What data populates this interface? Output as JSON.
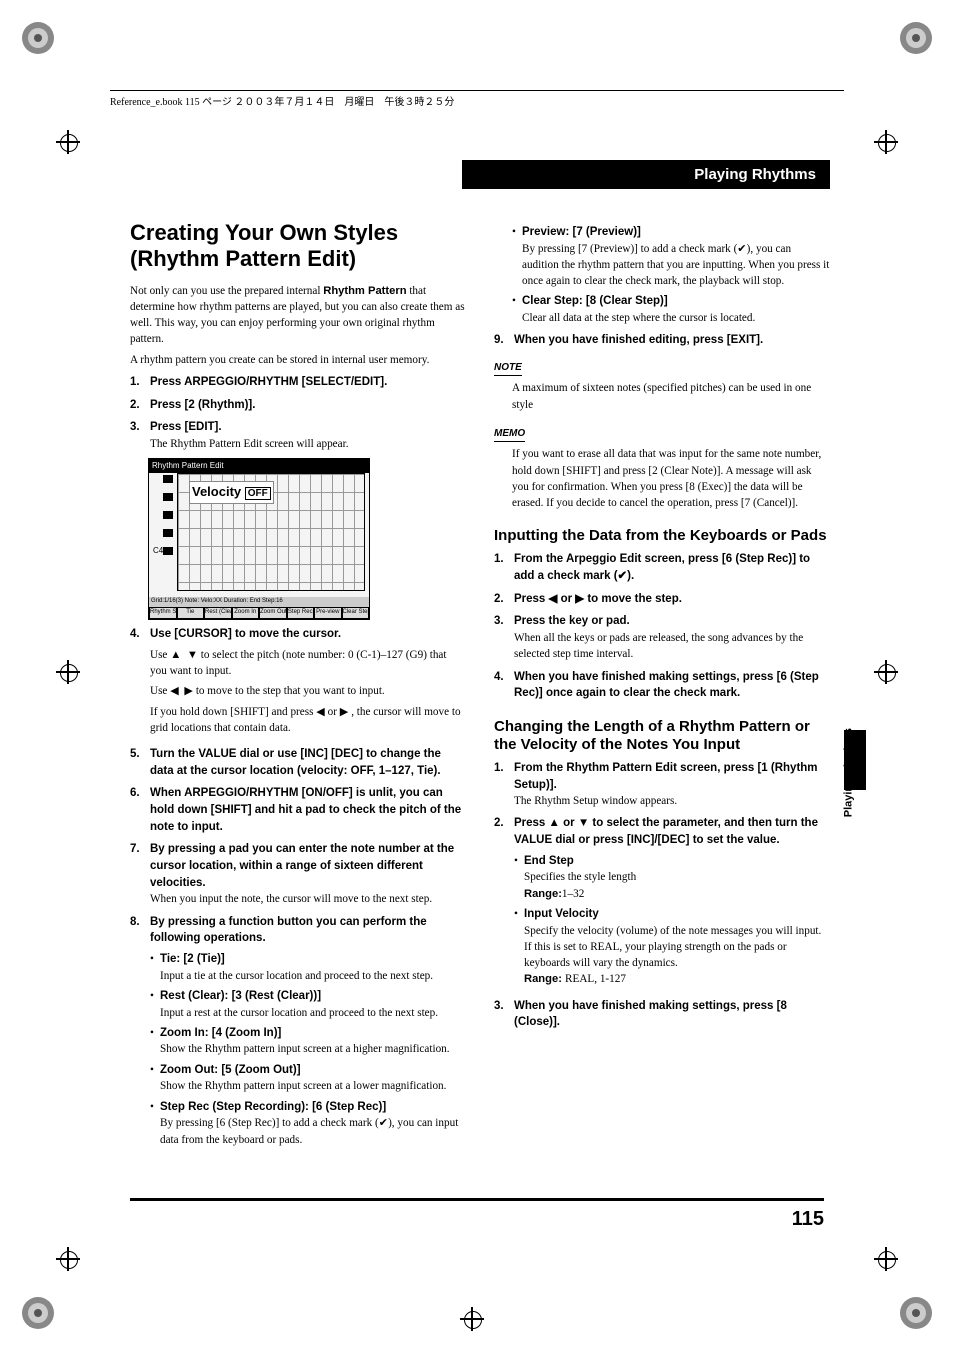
{
  "header": {
    "running": "Reference_e.book  115 ページ  ２００３年７月１４日　月曜日　午後３時２５分"
  },
  "section_label": "Playing Rhythms",
  "side_tab": "Playing Rhythms",
  "page_number": "115",
  "article": {
    "title": "Creating Your Own Styles (Rhythm Pattern Edit)",
    "intro1": "Not only can you use the prepared internal ",
    "intro1_bold": "Rhythm Pattern",
    "intro1_cont": " that determine how rhythm patterns are played, but you can also create them as well. This way, you can enjoy performing your own original rhythm pattern.",
    "intro2": "A rhythm pattern you create can be stored in internal user memory."
  },
  "screenshot": {
    "title": "Rhythm Pattern Edit",
    "velocity": "Velocity",
    "velocity_val": "OFF",
    "c4": "C4",
    "velo_row": "Velo",
    "info_row": "Grid:1/16(3)   Note:  Velo:XX  Duration:    End Step:16",
    "tabs": [
      "Rhythm Setup",
      "Tie",
      "Rest (Clear)",
      "Zoom In",
      "Zoom Out",
      "Step Rec",
      "Pre-view",
      "Clear Step"
    ]
  },
  "stepsL": {
    "s1": "Press ARPEGGIO/RHYTHM [SELECT/EDIT].",
    "s2": "Press [2 (Rhythm)].",
    "s3": "Press [EDIT].",
    "s3b": "The Rhythm Pattern Edit screen will appear.",
    "s4": "Use [CURSOR] to move the cursor.",
    "s4a_pre": "Use  ",
    "s4a_post": "  to select the pitch (note number: 0 (C-1)–127 (G9) that you want to input.",
    "s4b_pre": "Use  ",
    "s4b_post": "  to move to the step that you want to input.",
    "s4c_pre": "If you hold down [SHIFT] and press  ",
    "s4c_mid": "  or  ",
    "s4c_post": " , the cursor will move to grid locations that contain data.",
    "s5": "Turn the VALUE dial or use [INC] [DEC] to change the data at the cursor location (velocity: OFF, 1–127, Tie).",
    "s6": "When ARPEGGIO/RHYTHM [ON/OFF] is unlit, you can hold down [SHIFT] and hit a pad to check the pitch of the note to input.",
    "s7": "By pressing a pad you can enter the note number at the cursor location, within a range of sixteen different velocities.",
    "s7b": "When you input the note, the cursor will move to the next step.",
    "s8": "By pressing a function button you can perform the following operations.",
    "b_tie_h": "Tie: [2 (Tie)]",
    "b_tie_b": "Input a tie at the cursor location and proceed to the next step.",
    "b_rest_h": "Rest (Clear): [3 (Rest (Clear))]",
    "b_rest_b": "Input a rest at the cursor location and proceed to the next step.",
    "b_zin_h": "Zoom In: [4 (Zoom In)]",
    "b_zin_b": "Show the Rhythm pattern input screen at a higher magnification.",
    "b_zout_h": "Zoom Out: [5 (Zoom Out)]",
    "b_zout_b": "Show the Rhythm pattern input screen at a lower magnification.",
    "b_srec_h": "Step Rec (Step Recording): [6 (Step Rec)]",
    "b_srec_b": "By pressing [6 (Step Rec)] to add a check mark (✔), you can input data from the keyboard or pads."
  },
  "stepsR": {
    "b_prev_h": "Preview: [7 (Preview)]",
    "b_prev_b": "By pressing [7 (Preview)] to add a check mark (✔), you can audition the rhythm pattern that you are inputting. When you press it once again to clear the check mark, the playback will stop.",
    "b_clr_h": "Clear Step: [8 (Clear Step)]",
    "b_clr_b": "Clear all data at the step where the cursor is located.",
    "s9": "When you have finished editing, press [EXIT].",
    "note_label": "NOTE",
    "note_body": "A maximum of sixteen notes (specified pitches) can be used in one style",
    "memo_label": "MEMO",
    "memo_body": "If you want to erase all data that was input for the same note number, hold down [SHIFT] and press [2 (Clear Note)]. A message will ask you for confirmation. When you press [8 (Exec)] the data will be erased. If you decide to cancel the operation, press [7 (Cancel)]."
  },
  "sec2": {
    "title": "Inputting the Data from the Keyboards or Pads",
    "s1": "From the Arpeggio Edit screen, press [6 (Step Rec)] to add a check mark (✔).",
    "s2_pre": "Press  ",
    "s2_mid": "  or  ",
    "s2_post": "  to move the step.",
    "s3": "Press the key or pad.",
    "s3b": "When all the keys or pads are released, the song advances by the selected step time interval.",
    "s4": "When you have finished making settings, press [6 (Step Rec)] once again to clear the check mark."
  },
  "sec3": {
    "title": "Changing the Length of a Rhythm Pattern or the Velocity of the Notes You Input",
    "s1": "From the Rhythm Pattern Edit screen, press [1 (Rhythm Setup)].",
    "s1b": "The Rhythm Setup window appears.",
    "s2_pre": "Press  ",
    "s2_mid": "  or  ",
    "s2_post": "  to select the parameter, and then turn the VALUE dial or press [INC]/[DEC] to set the value.",
    "b_end_h": "End Step",
    "b_end_b": "Specifies the style length",
    "b_end_r_label": "Range:",
    "b_end_r_val": "1–32",
    "b_iv_h": "Input Velocity",
    "b_iv_b1": "Specify the velocity (volume) of the note messages you will input.",
    "b_iv_b2": "If this is set to REAL, your playing strength on the pads or keyboards will vary the dynamics.",
    "b_iv_r_label": "Range: ",
    "b_iv_r_val": "REAL, 1-127",
    "s3": "When you have finished making settings, press [8 (Close)]."
  }
}
